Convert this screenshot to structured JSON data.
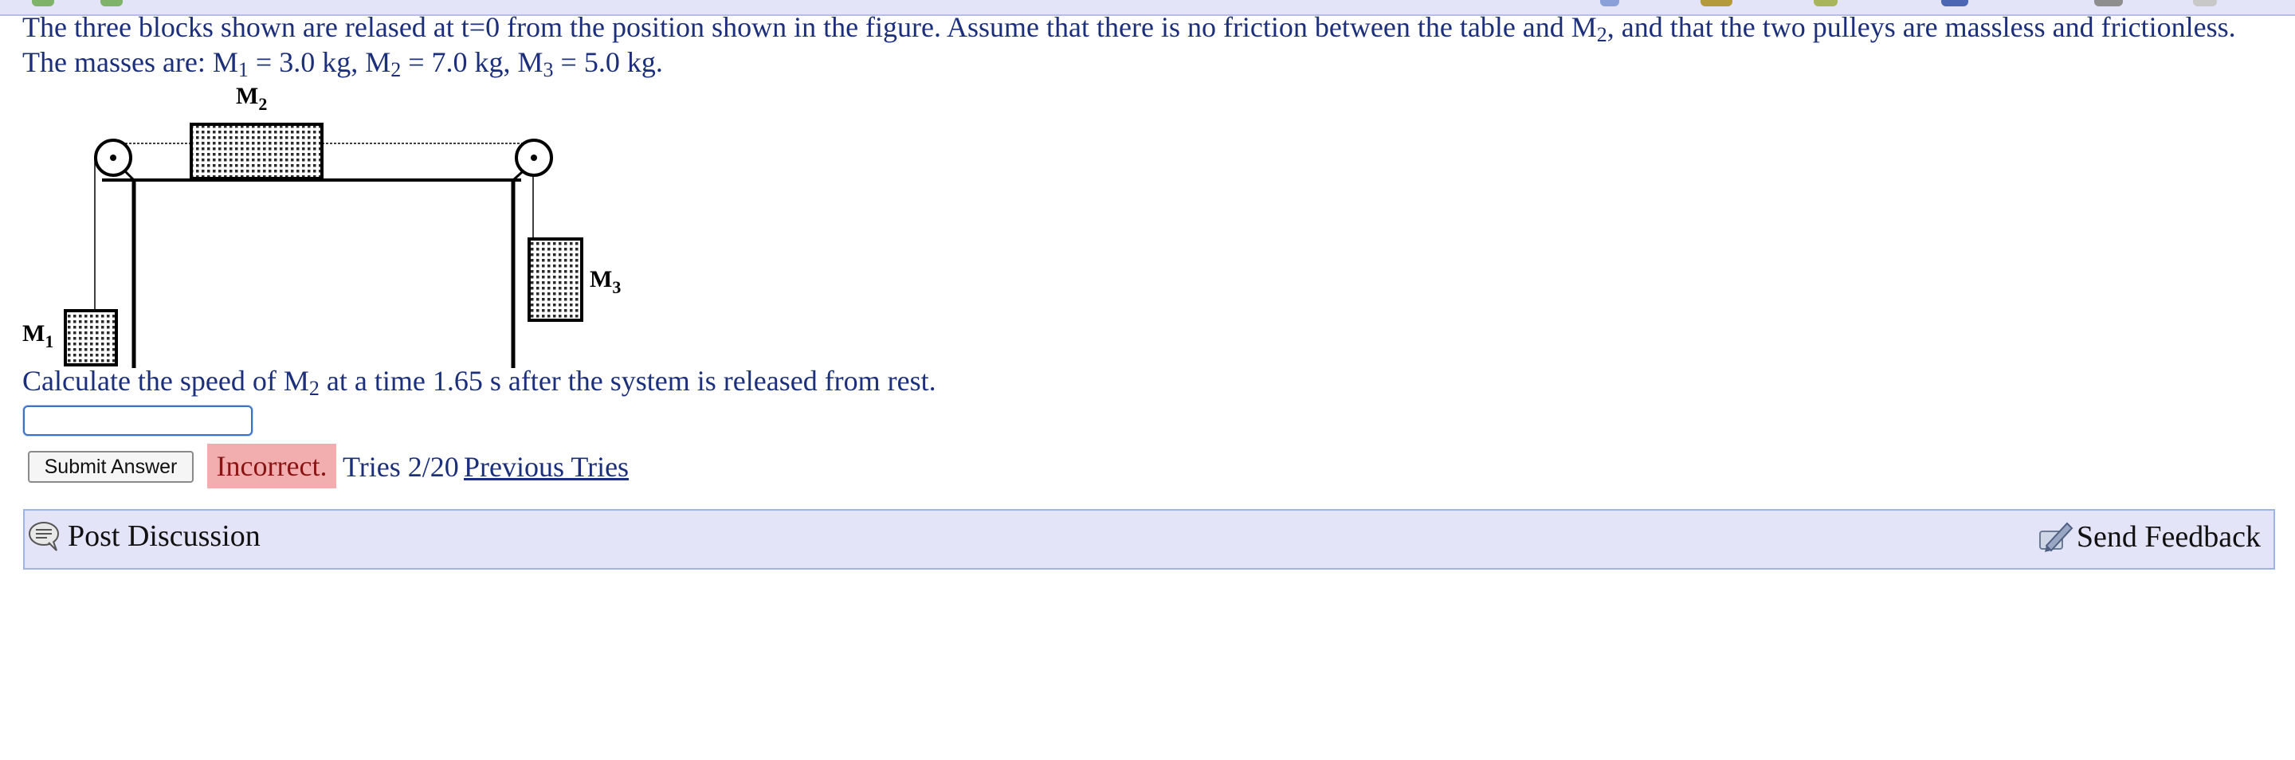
{
  "problem": {
    "line1_part1": "The three blocks shown are relased at t=0 from the position shown in the figure. Assume that there is no friction between the table and M",
    "line1_sub": "2",
    "line1_part2": ", and that the two pulleys are massless and frictionless.",
    "masses_intro": "The masses are: M",
    "m1_sub": "1",
    "m1_value": " = 3.0 kg, M",
    "m2_sub": "2",
    "m2_value": " = 7.0 kg, M",
    "m3_sub": "3",
    "m3_value": " = 5.0 kg."
  },
  "figure": {
    "label_m1": "M",
    "label_m1_sub": "1",
    "label_m2": "M",
    "label_m2_sub": "2",
    "label_m3": "M",
    "label_m3_sub": "3"
  },
  "question": {
    "part1": "Calculate the speed of M",
    "sub": "2",
    "part2": " at a time 1.65 s after the system is released from rest."
  },
  "answer": {
    "value": "",
    "placeholder": ""
  },
  "controls": {
    "submit_label": "Submit Answer",
    "status": "Incorrect.",
    "tries": "Tries 2/20",
    "previous_tries": "Previous Tries"
  },
  "discussion": {
    "post_label": "Post Discussion",
    "feedback_label": "Send Feedback"
  },
  "colors": {
    "text": "#1c2f7a",
    "incorrect_bg": "#f2aeae",
    "bar_bg": "#e4e4f8",
    "input_border": "#3a72c9"
  },
  "icons": {
    "post": "speech-bubble-icon",
    "feedback": "feedback-pencil-icon"
  }
}
